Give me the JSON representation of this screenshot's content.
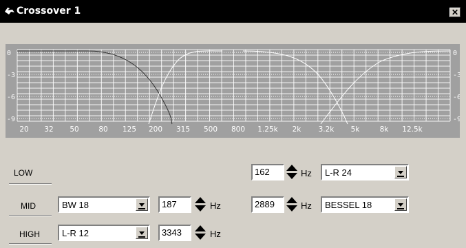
{
  "window": {
    "title": "Crossover 1",
    "close_label": "✕"
  },
  "graph": {
    "y_labels": [
      "0",
      "-3",
      "-6",
      "-9"
    ],
    "x_labels": [
      "20",
      "32",
      "50",
      "80",
      "125",
      "200",
      "315",
      "500",
      "800",
      "1.25k",
      "2k",
      "3.2k",
      "5k",
      "8k",
      "12.5k"
    ]
  },
  "bands": {
    "low": {
      "label": "LOW",
      "freq": "162",
      "unit": "Hz",
      "filter": "L-R 24"
    },
    "mid": {
      "label": "MID",
      "lo_filter": "BW 18",
      "lo_freq": "187",
      "hi_freq": "2889",
      "unit": "Hz",
      "hi_filter": "BESSEL 18"
    },
    "high": {
      "label": "HIGH",
      "filter": "L-R 12",
      "freq": "3343",
      "unit": "Hz"
    }
  },
  "colors": {
    "graph_bg": "#a0a0a0",
    "grid": "#ffffff",
    "title_bg": "#000000",
    "window_bg": "#d4d0c8"
  }
}
